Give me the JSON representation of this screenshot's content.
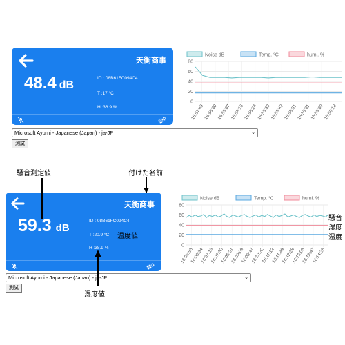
{
  "panels": [
    {
      "brand": "天衡商事",
      "db_value": "48.4",
      "db_unit": "dB",
      "device_id": "ID : 08B61FC094C4",
      "temperature": "T :17 °C",
      "humidity": "H :36.9 %",
      "voice_select": "Microsoft Ayumi - Japanese (Japan) - ja-JP",
      "test_button": "測試",
      "chart_data": {
        "type": "line",
        "legend": [
          "Noise dB",
          "Temp. °C",
          "humi. %"
        ],
        "colors": [
          "#6cc2c9",
          "#5aa8e0",
          "#f08a9a"
        ],
        "ylim": [
          0,
          80
        ],
        "yticks": [
          0,
          20,
          40,
          60,
          80
        ],
        "x": [
          "15:57:49",
          "15:58:00",
          "15:58:07",
          "15:58:16",
          "15:58:24",
          "15:58:33",
          "15:58:42",
          "15:58:51",
          "15:59:01",
          "15:59:09",
          "15:59:18"
        ],
        "series": [
          {
            "name": "Noise dB",
            "values": [
              69,
              52,
              48,
              48,
              48,
              47,
              48,
              48,
              48,
              48,
              47,
              48,
              48,
              48,
              48,
              48,
              49,
              48,
              48,
              48,
              48
            ]
          },
          {
            "name": "Temp. °C",
            "values": [
              17,
              17,
              17,
              17,
              17,
              17,
              17,
              17,
              17,
              17,
              17,
              17,
              17,
              17,
              17,
              17,
              17,
              17,
              17,
              17,
              17
            ]
          },
          {
            "name": "humi. %",
            "values": [
              37,
              37,
              37,
              37,
              37,
              37,
              37,
              37,
              37,
              37,
              37,
              37,
              37,
              37,
              37,
              37,
              37,
              37,
              37,
              37,
              37
            ]
          }
        ]
      }
    },
    {
      "brand": "天衡商事",
      "db_value": "59.3",
      "db_unit": "dB",
      "device_id": "ID : 08B61FC094C4",
      "temperature": "T :20.9 °C",
      "humidity": "H :38.9 %",
      "voice_select": "Microsoft Ayumi - Japanese (Japan) - ja-JP",
      "test_button": "測試",
      "chart_data": {
        "type": "line",
        "legend": [
          "Noise dB",
          "Temp. °C",
          "humi. %"
        ],
        "colors": [
          "#6cc2c9",
          "#5aa8e0",
          "#f08a9a"
        ],
        "ylim": [
          0,
          80
        ],
        "yticks": [
          0,
          20,
          40,
          60,
          80
        ],
        "x": [
          "16:05:56",
          "16:06:34",
          "16:07:13",
          "16:07:53",
          "16:08:31",
          "16:09:09",
          "16:09:47",
          "16:10:32",
          "16:11:12",
          "16:11:49",
          "16:12:28",
          "16:13:08",
          "16:13:47",
          "16:14:28"
        ],
        "series": [
          {
            "name": "Noise dB",
            "values": [
              55,
              59,
              56,
              60,
              57,
              58,
              61,
              55,
              59,
              57,
              60,
              56,
              58,
              62,
              57,
              55,
              60,
              58,
              56,
              59,
              61,
              57,
              55,
              58,
              60,
              56,
              59,
              57,
              61,
              58,
              55,
              60,
              57,
              59,
              62,
              56,
              58,
              60,
              57,
              55,
              59,
              61,
              58,
              56,
              60,
              57,
              59,
              58,
              56,
              61
            ]
          },
          {
            "name": "Temp. °C",
            "values": [
              21,
              21,
              21,
              21,
              21,
              21,
              21,
              21,
              21,
              21,
              21,
              21,
              21,
              21,
              21,
              21,
              21,
              21,
              21,
              21,
              21,
              21,
              21,
              21,
              21,
              21,
              21,
              21,
              21,
              21,
              21,
              21,
              21,
              21,
              21,
              21,
              21,
              21,
              21,
              21,
              21,
              21,
              21,
              21,
              21,
              21,
              21,
              21,
              21,
              21
            ]
          },
          {
            "name": "humi. %",
            "values": [
              39,
              39,
              39,
              39,
              39,
              39,
              39,
              39,
              39,
              39,
              39,
              39,
              39,
              39,
              39,
              39,
              39,
              39,
              39,
              39,
              39,
              39,
              39,
              39,
              39,
              39,
              39,
              39,
              39,
              39,
              39,
              39,
              39,
              39,
              39,
              39,
              39,
              39,
              39,
              39,
              39,
              39,
              39,
              39,
              39,
              39,
              39,
              39,
              39,
              39
            ]
          }
        ]
      }
    }
  ],
  "annotations": {
    "noise_value": "騒音測定値",
    "given_name": "付けた名前",
    "temperature_value": "温度値",
    "humidity_value": "湿度値",
    "side_noise": "騒音",
    "side_humidity": "湿度",
    "side_temperature": "温度"
  }
}
